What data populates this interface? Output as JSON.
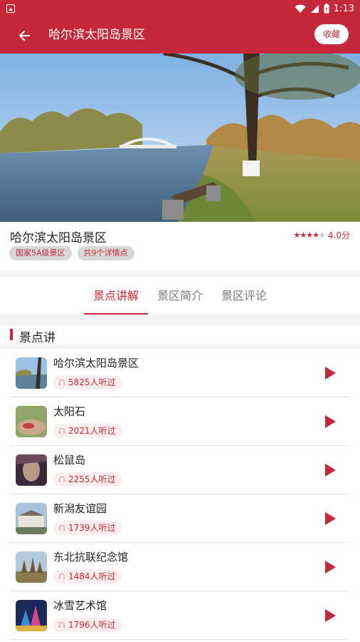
{
  "status_bar": {
    "time": "1:13"
  },
  "app_bar": {
    "title": "哈尔滨太阳岛景区",
    "favorite_label": "收藏"
  },
  "scenic": {
    "name": "哈尔滨太阳岛景区",
    "rating_text": "4.0分",
    "rating_stars": 4,
    "rating_max": 5,
    "tags": [
      "国家5A级景区",
      "共9个详情点"
    ]
  },
  "tabs": [
    {
      "label": "景点讲解",
      "active": true
    },
    {
      "label": "景区简介",
      "active": false
    },
    {
      "label": "景区评论",
      "active": false
    }
  ],
  "section_title": "景点讲",
  "spots": [
    {
      "name": "哈尔滨太阳岛景区",
      "listens": "5825人听过"
    },
    {
      "name": "太阳石",
      "listens": "2021人听过"
    },
    {
      "name": "松鼠岛",
      "listens": "2255人听过"
    },
    {
      "name": "新潟友谊园",
      "listens": "1739人听过"
    },
    {
      "name": "东北抗联纪念馆",
      "listens": "1484人听过"
    },
    {
      "name": "冰雪艺术馆",
      "listens": "1796人听过"
    }
  ],
  "colors": {
    "accent": "#c4283a",
    "tag_bg": "#d8d8d8",
    "pill_bg": "#fbeeee"
  }
}
